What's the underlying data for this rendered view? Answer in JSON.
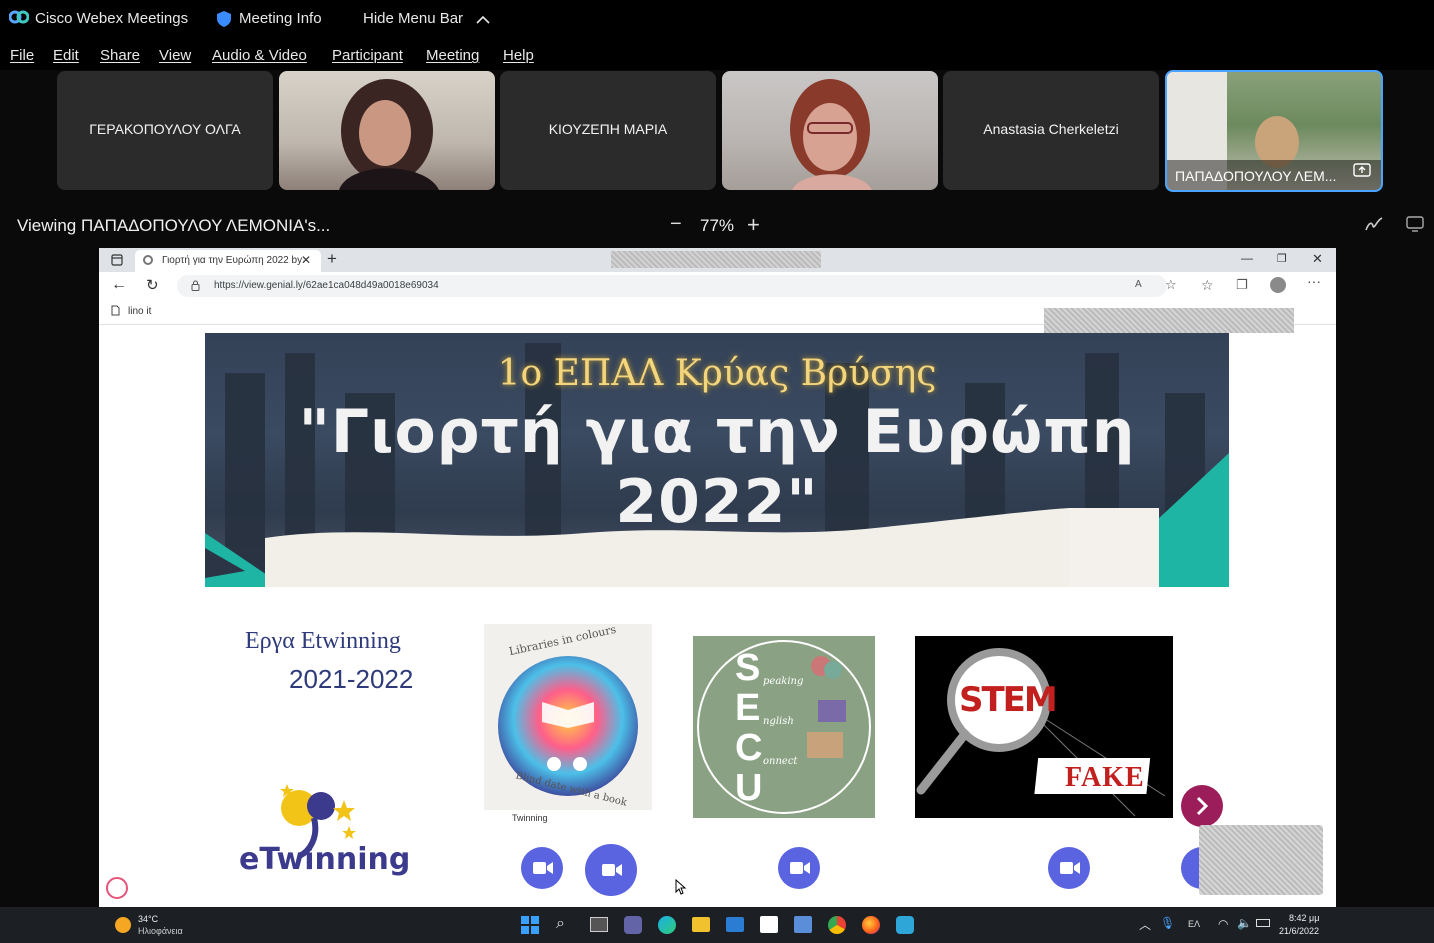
{
  "titlebar": {
    "app_name": "Cisco Webex Meetings",
    "meeting_info": "Meeting Info",
    "hide_menu_bar": "Hide Menu Bar"
  },
  "menu": [
    "File",
    "Edit",
    "Share",
    "View",
    "Audio & Video",
    "Participant",
    "Meeting",
    "Help"
  ],
  "participants": [
    {
      "name": "ΓΕΡΑΚΟΠΟΥΛΟΥ ΟΛΓΑ",
      "video": false
    },
    {
      "name": "",
      "video": true
    },
    {
      "name": "ΚΙΟΥΖΕΠΗ ΜΑΡΙΑ",
      "video": false
    },
    {
      "name": "",
      "video": true
    },
    {
      "name": "Anastasia Cherkeletzi",
      "video": false
    },
    {
      "name": "ΠΑΠΑΔΟΠΟΥΛΟΥ ΛΕΜ...",
      "video": true,
      "active": true
    }
  ],
  "sharebar": {
    "viewing": "Viewing ΠΑΠΑΔΟΠΟΥΛΟΥ ΛΕΜΟΝΙΑ's...",
    "zoom": "77%",
    "minus": "−",
    "plus": "+"
  },
  "browser": {
    "tab_title": "Γιορτή για την Ευρώπη 2022 by",
    "url": "https://view.genial.ly/62ae1ca048d49a0018e69034",
    "favorite": "lino it"
  },
  "banner": {
    "subtitle": "1ο ΕΠΑΛ Κρύας Βρύσης",
    "title": "\"Γιορτή για την Ευρώπη 2022\""
  },
  "content": {
    "heading_line1": "Εργα Etwinning",
    "heading_line2": "2021-2022",
    "etwinning_logo": "eTwinning",
    "card1_text_top": "Libraries in colours",
    "card1_text_bottom": "Blind date with a book",
    "card1_badge": "Twinning",
    "card2_letters": [
      "S",
      "E",
      "C",
      "U"
    ],
    "card2_words": [
      "peaking",
      "nglish",
      "onnect",
      ""
    ],
    "card3_sign": "STEM",
    "card3_fake": "FAKE"
  },
  "taskbar": {
    "temp": "34°C",
    "weather": "Ηλιοφάνεια",
    "lang": "ΕΛ",
    "time": "8:42 μμ",
    "date": "21/6/2022"
  },
  "colors": {
    "active_border": "#4aa3ff",
    "video_button": "#5a64e0",
    "next_button": "#9b1d5a",
    "banner_gold": "#f3d57d"
  }
}
